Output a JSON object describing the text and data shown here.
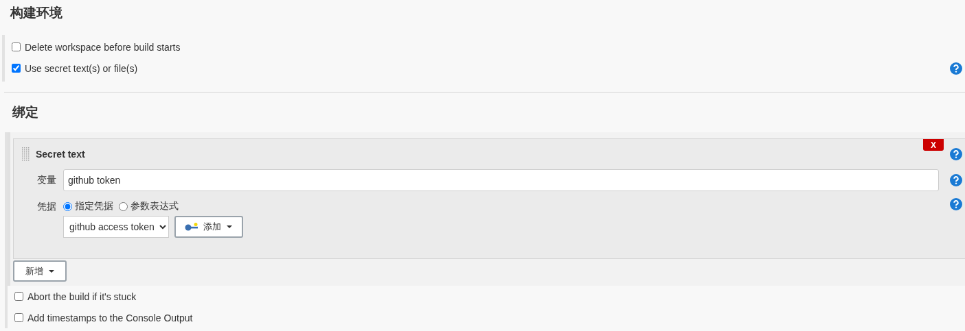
{
  "sections": [
    {
      "title": "构建环境",
      "options": [
        {
          "label": "Delete workspace before build starts",
          "checked": false
        },
        {
          "label": "Use secret text(s) or file(s)",
          "checked": true,
          "help": true
        }
      ]
    }
  ],
  "bindings": {
    "title": "绑定",
    "items": [
      {
        "title": "Secret text",
        "delete": "X",
        "variable_label": "变量",
        "variable_value": "github token",
        "credentials_label": "凭据",
        "modes": [
          {
            "label": "指定凭据",
            "selected": true
          },
          {
            "label": "参数表达式",
            "selected": false
          }
        ],
        "credential": "github access token",
        "add_button": "添加"
      }
    ],
    "new_button": "新增"
  },
  "more_options": [
    {
      "label": "Abort the build if it's stuck",
      "checked": false
    },
    {
      "label": "Add timestamps to the Console Output",
      "checked": false
    }
  ]
}
